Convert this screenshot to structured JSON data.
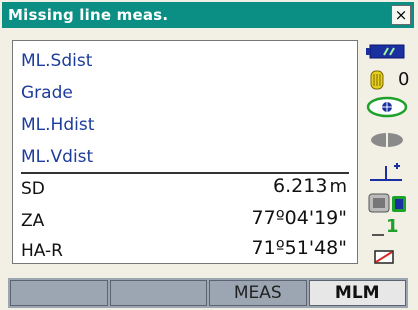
{
  "window": {
    "title": "Missing line meas.",
    "close_glyph": "×"
  },
  "measurement_items": [
    "ML.Sdist",
    "Grade",
    "ML.Hdist",
    "ML.Vdist"
  ],
  "readings": [
    {
      "label": "SD",
      "value": "6.213",
      "unit": "m"
    },
    {
      "label": "ZA",
      "value": "77º04'19\"",
      "unit": ""
    },
    {
      "label": "HA-R",
      "value": "71º51'48\"",
      "unit": ""
    }
  ],
  "status": {
    "icons": [
      "battery-icon",
      "prism-icon",
      "target-icon",
      "laser-icon",
      "tilt-icon",
      "bluetooth-icon",
      "signal-icon",
      "input-mode-icon"
    ],
    "prism_constant": "0",
    "signal_level": "1"
  },
  "softkeys": [
    "",
    "",
    "MEAS",
    "MLM"
  ],
  "colors": {
    "title_bar": "#0b8f84",
    "item_text": "#1d3d9b",
    "softkey_bar": "#9ba6b2"
  }
}
